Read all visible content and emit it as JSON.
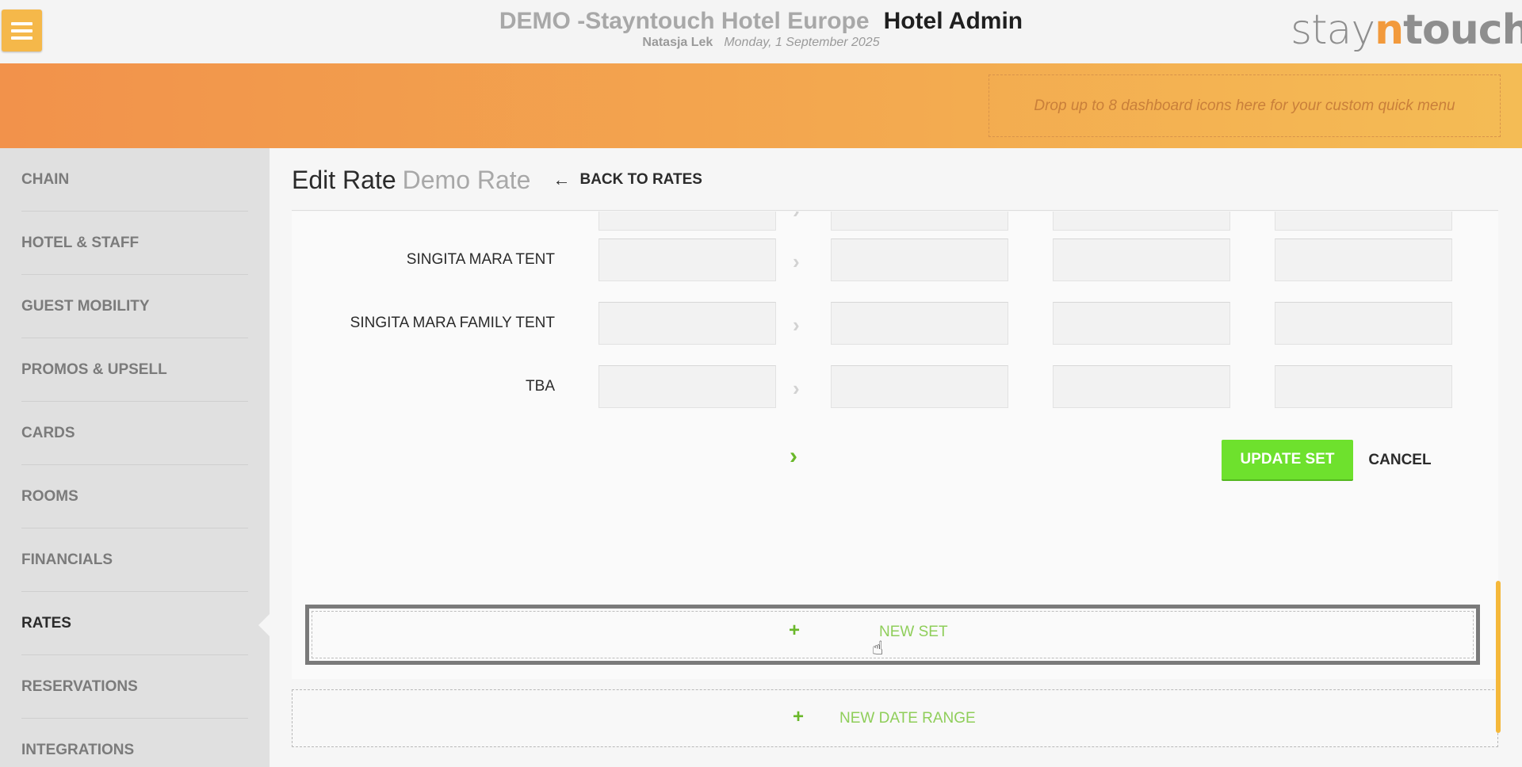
{
  "header": {
    "hotel_name": "DEMO -Stayntouch Hotel Europe",
    "app_name": "Hotel Admin",
    "user_name": "Natasja Lek",
    "date": "Monday, 1 September 2025",
    "logo": {
      "part1": "stay",
      "part2": "n",
      "part3": "touch"
    }
  },
  "quick_menu": {
    "dropzone_text": "Drop up to 8 dashboard icons here for your custom quick menu"
  },
  "sidebar": {
    "items": [
      {
        "label": "CHAIN"
      },
      {
        "label": "HOTEL & STAFF"
      },
      {
        "label": "GUEST MOBILITY"
      },
      {
        "label": "PROMOS & UPSELL"
      },
      {
        "label": "CARDS"
      },
      {
        "label": "ROOMS"
      },
      {
        "label": "FINANCIALS"
      },
      {
        "label": "RATES",
        "active": true
      },
      {
        "label": "RESERVATIONS"
      },
      {
        "label": "INTEGRATIONS"
      }
    ]
  },
  "page": {
    "title": "Edit Rate",
    "rate_name": "Demo Rate",
    "back_label": "BACK TO RATES"
  },
  "rate_set": {
    "rooms": [
      {
        "label": "SINGITA MARA TENT"
      },
      {
        "label": "SINGITA MARA FAMILY TENT"
      },
      {
        "label": "TBA"
      }
    ],
    "update_label": "UPDATE SET",
    "cancel_label": "CANCEL"
  },
  "new_set": {
    "plus": "+",
    "label": "NEW SET"
  },
  "new_date_range": {
    "plus": "+",
    "label": "NEW DATE RANGE"
  },
  "colors": {
    "accent_orange": "#f4a64d",
    "menu_button": "#f5b84a",
    "update_green": "#6ee12d",
    "link_green": "#8fce5a"
  }
}
